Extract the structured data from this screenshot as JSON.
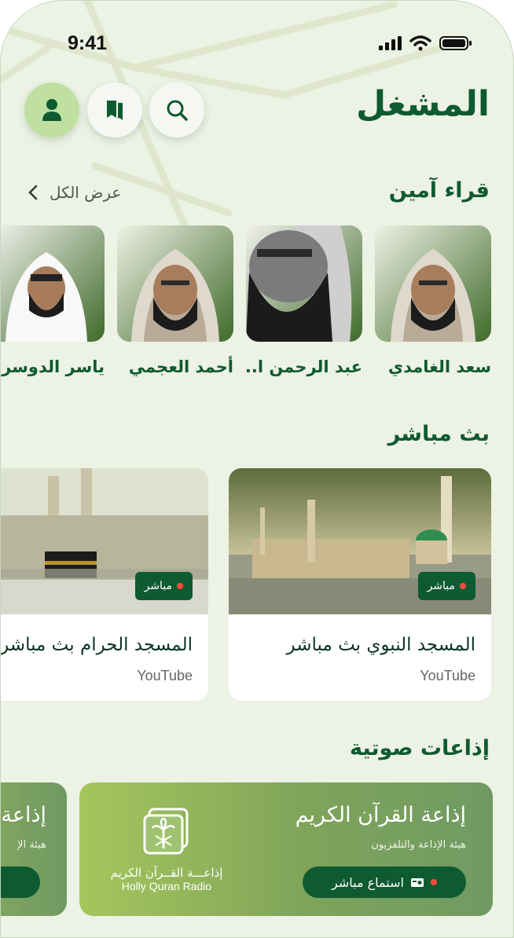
{
  "status_bar": {
    "time": "9:41"
  },
  "header": {
    "title": "المشغل"
  },
  "readers": {
    "title": "قراء آمين",
    "view_all": "عرض الكل",
    "items": [
      {
        "name": "سعد الغامدي"
      },
      {
        "name": "عبد الرحمن ا.."
      },
      {
        "name": "أحمد العجمي"
      },
      {
        "name": "ياسر الدوسري"
      }
    ]
  },
  "live": {
    "title": "بث مباشر",
    "items": [
      {
        "title": "المسجد النبوي بث مباشر",
        "source": "YouTube",
        "badge": "مباشر"
      },
      {
        "title": "المسجد الحرام بث مباشر",
        "source": "YouTube",
        "badge": "مباشر"
      }
    ]
  },
  "radios": {
    "title": "إذاعات صوتية",
    "items": [
      {
        "title": "إذاعة القرآن الكريم",
        "subtitle": "هيئة الإذاعة والتلفزيون",
        "button": "استماع مباشر",
        "logo_ar": "إذاعـــة القــرآن الكريم",
        "logo_en": "Holly Quran Radio"
      },
      {
        "title": "إذاعة",
        "subtitle": "هيئة الإ"
      }
    ]
  },
  "colors": {
    "brand": "#0e5a31",
    "background": "#ecf2e4",
    "accent": "#bfe0a0",
    "live_dot": "#ff4b3e"
  },
  "icons": [
    "user-icon",
    "bookmark-icon",
    "search-icon",
    "chevron-left-icon",
    "radio-icon",
    "signal-icon",
    "wifi-icon",
    "battery-icon"
  ]
}
